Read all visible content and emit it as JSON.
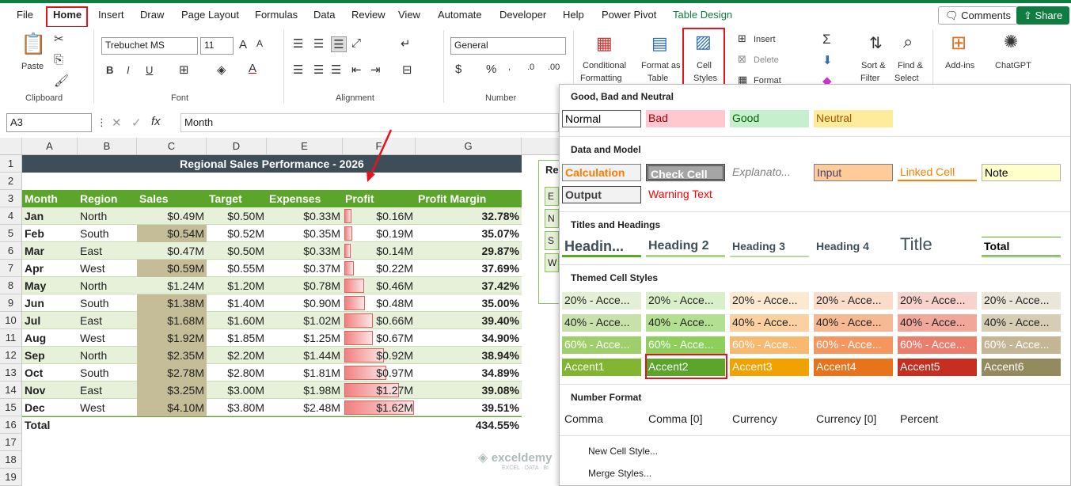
{
  "menu_tabs": [
    "File",
    "Home",
    "Insert",
    "Draw",
    "Page Layout",
    "Formulas",
    "Data",
    "Review",
    "View",
    "Automate",
    "Developer",
    "Help",
    "Power Pivot",
    "Table Design"
  ],
  "comments_label": "Comments",
  "share_label": "Share",
  "ribbon": {
    "paste": "Paste",
    "clipboard": "Clipboard",
    "font_name": "Trebuchet MS",
    "font_size": "11",
    "font_group": "Font",
    "alignment_group": "Alignment",
    "number_format": "General",
    "number_group": "Number",
    "conditional": [
      "Conditional",
      "Formatting"
    ],
    "format_table": [
      "Format as",
      "Table"
    ],
    "cell_styles": [
      "Cell",
      "Styles"
    ],
    "insert": "Insert",
    "delete": "Delete",
    "format": "Format",
    "sort": [
      "Sort &",
      "Filter"
    ],
    "find": [
      "Find &",
      "Select"
    ],
    "addins": "Add-ins",
    "chatgpt": "ChatGPT",
    "bold": "B",
    "italic": "I",
    "underline": "U",
    "dollar": "$",
    "percent": "%",
    "sigma": "Σ",
    "fx": "fx",
    "ax": "A"
  },
  "name_box": "A3",
  "formula_value": "Month",
  "columns": [
    "A",
    "B",
    "C",
    "D",
    "E",
    "F",
    "G"
  ],
  "rows": [
    "1",
    "2",
    "3",
    "4",
    "5",
    "6",
    "7",
    "8",
    "9",
    "10",
    "11",
    "12",
    "13",
    "14",
    "15",
    "16",
    "17",
    "18",
    "19"
  ],
  "sheet": {
    "title": "Regional Sales Performance - 2026",
    "headers": [
      "Month",
      "Region",
      "Sales",
      "Target",
      "Expenses",
      "Profit",
      "Profit Margin"
    ],
    "data": [
      [
        "Jan",
        "North",
        "$0.49M",
        "$0.50M",
        "$0.33M",
        "$0.16M",
        "32.78%"
      ],
      [
        "Feb",
        "South",
        "$0.54M",
        "$0.52M",
        "$0.35M",
        "$0.19M",
        "35.07%"
      ],
      [
        "Mar",
        "East",
        "$0.47M",
        "$0.50M",
        "$0.33M",
        "$0.14M",
        "29.87%"
      ],
      [
        "Apr",
        "West",
        "$0.59M",
        "$0.55M",
        "$0.37M",
        "$0.22M",
        "37.69%"
      ],
      [
        "May",
        "North",
        "$1.24M",
        "$1.20M",
        "$0.78M",
        "$0.46M",
        "37.42%"
      ],
      [
        "Jun",
        "South",
        "$1.38M",
        "$1.40M",
        "$0.90M",
        "$0.48M",
        "35.00%"
      ],
      [
        "Jul",
        "East",
        "$1.68M",
        "$1.60M",
        "$1.02M",
        "$0.66M",
        "39.40%"
      ],
      [
        "Aug",
        "West",
        "$1.92M",
        "$1.85M",
        "$1.25M",
        "$0.67M",
        "34.90%"
      ],
      [
        "Sep",
        "North",
        "$2.35M",
        "$2.20M",
        "$1.44M",
        "$0.92M",
        "38.94%"
      ],
      [
        "Oct",
        "South",
        "$2.78M",
        "$2.80M",
        "$1.81M",
        "$0.97M",
        "34.89%"
      ],
      [
        "Nov",
        "East",
        "$3.25M",
        "$3.00M",
        "$1.98M",
        "$1.27M",
        "39.08%"
      ],
      [
        "Dec",
        "West",
        "$4.10M",
        "$3.80M",
        "$2.48M",
        "$1.62M",
        "39.51%"
      ]
    ],
    "total_label": "Total",
    "total_value": "434.55%",
    "side_fragments": [
      "Re",
      "E",
      "N",
      "S",
      "W"
    ]
  },
  "cell_styles": {
    "sections": [
      "Good, Bad and Neutral",
      "Data and Model",
      "Titles and Headings",
      "Themed Cell Styles",
      "Number Format"
    ],
    "good_bad": [
      "Normal",
      "Bad",
      "Good",
      "Neutral"
    ],
    "data_model_row1": [
      "Calculation",
      "Check Cell",
      "Explanato...",
      "Input",
      "Linked Cell",
      "Note"
    ],
    "data_model_row2": [
      "Output",
      "Warning Text"
    ],
    "titles": [
      "Headin...",
      "Heading 2",
      "Heading 3",
      "Heading 4",
      "Title",
      "Total"
    ],
    "themed_20": [
      "20% - Acce...",
      "20% - Acce...",
      "20% - Acce...",
      "20% - Acce...",
      "20% - Acce...",
      "20% - Acce..."
    ],
    "themed_40": [
      "40% - Acce...",
      "40% - Acce...",
      "40% - Acce...",
      "40% - Acce...",
      "40% - Acce...",
      "40% - Acce..."
    ],
    "themed_60": [
      "60% - Acce...",
      "60% - Acce...",
      "60% - Acce...",
      "60% - Acce...",
      "60% - Acce...",
      "60% - Acce..."
    ],
    "accents": [
      "Accent1",
      "Accent2",
      "Accent3",
      "Accent4",
      "Accent5",
      "Accent6"
    ],
    "number_formats": [
      "Comma",
      "Comma [0]",
      "Currency",
      "Currency [0]",
      "Percent"
    ],
    "new_style": "New Cell Style...",
    "merge_styles": "Merge Styles..."
  },
  "watermark": "exceldemy",
  "watermark_sub": "EXCEL · DATA · BI",
  "colors": {
    "accent_green": "#107c41",
    "table_header": "#5aa52a",
    "title_bar": "#3d4e58",
    "highlight": "#e8121c"
  }
}
